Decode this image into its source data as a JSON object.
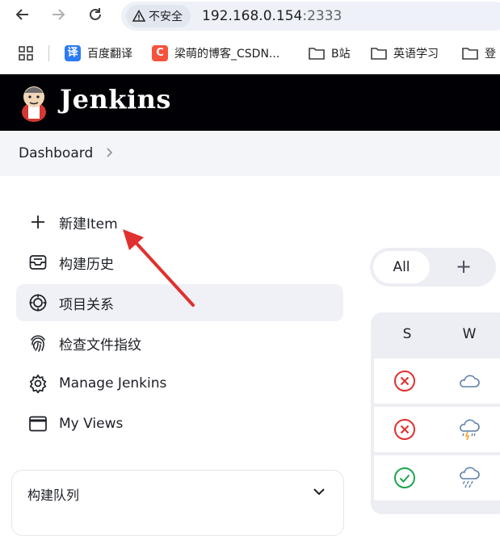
{
  "browser": {
    "security_label": "不安全",
    "url_host": "192.168.0.154",
    "url_port": ":2333",
    "bookmarks": [
      {
        "label": "百度翻译",
        "favicon_text": "译",
        "favicon_color": "#2b7bf2"
      },
      {
        "label": "梁萌的博客_CSDN...",
        "favicon_text": "C",
        "favicon_color": "#f5533d"
      },
      {
        "label": "B站"
      },
      {
        "label": "英语学习"
      },
      {
        "label": "登"
      }
    ]
  },
  "header": {
    "title": "Jenkins"
  },
  "breadcrumb": {
    "dashboard": "Dashboard"
  },
  "side_panel": {
    "tasks": [
      {
        "label": "新建Item",
        "icon": "plus-icon"
      },
      {
        "label": "构建历史",
        "icon": "inbox-icon"
      },
      {
        "label": "项目关系",
        "icon": "target-icon",
        "active": true
      },
      {
        "label": "检查文件指纹",
        "icon": "fingerprint-icon"
      },
      {
        "label": "Manage Jenkins",
        "icon": "gear-icon"
      },
      {
        "label": "My Views",
        "icon": "window-icon"
      }
    ],
    "build_queue": {
      "title": "构建队列"
    }
  },
  "view_tabs": {
    "all_label": "All",
    "add_label": "+"
  },
  "table": {
    "headers": [
      "S",
      "W"
    ],
    "rows": [
      {
        "status": "failed",
        "weather": "cloudy"
      },
      {
        "status": "failed",
        "weather": "thunderstorm"
      },
      {
        "status": "success",
        "weather": "rainy"
      }
    ]
  },
  "colors": {
    "header_bg": "#000005",
    "failed": "#e0302f",
    "success": "#1ea54d",
    "weather": "#5b7fa8",
    "arrow": "#e0302f"
  }
}
